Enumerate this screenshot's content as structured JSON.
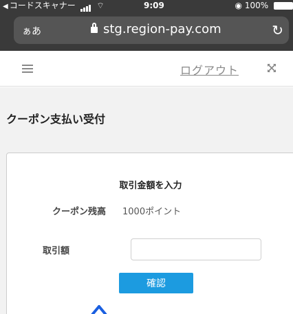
{
  "status_bar": {
    "back_app": "コードスキャナー",
    "time": "9:09",
    "battery": "100%"
  },
  "browser": {
    "text_size": "ぁあ",
    "url": "stg.region-pay.com"
  },
  "header": {
    "logout_label": "ログアウト"
  },
  "page": {
    "title": "クーポン支払い受付"
  },
  "form": {
    "heading": "取引金額を入力",
    "balance_label": "クーポン残高",
    "balance_value": "1000ポイント",
    "amount_label": "取引額",
    "amount_value": "",
    "amount_placeholder": "",
    "confirm_label": "確認"
  },
  "colors": {
    "accent": "#1c9be0",
    "chrome": "#3a3a3a"
  }
}
